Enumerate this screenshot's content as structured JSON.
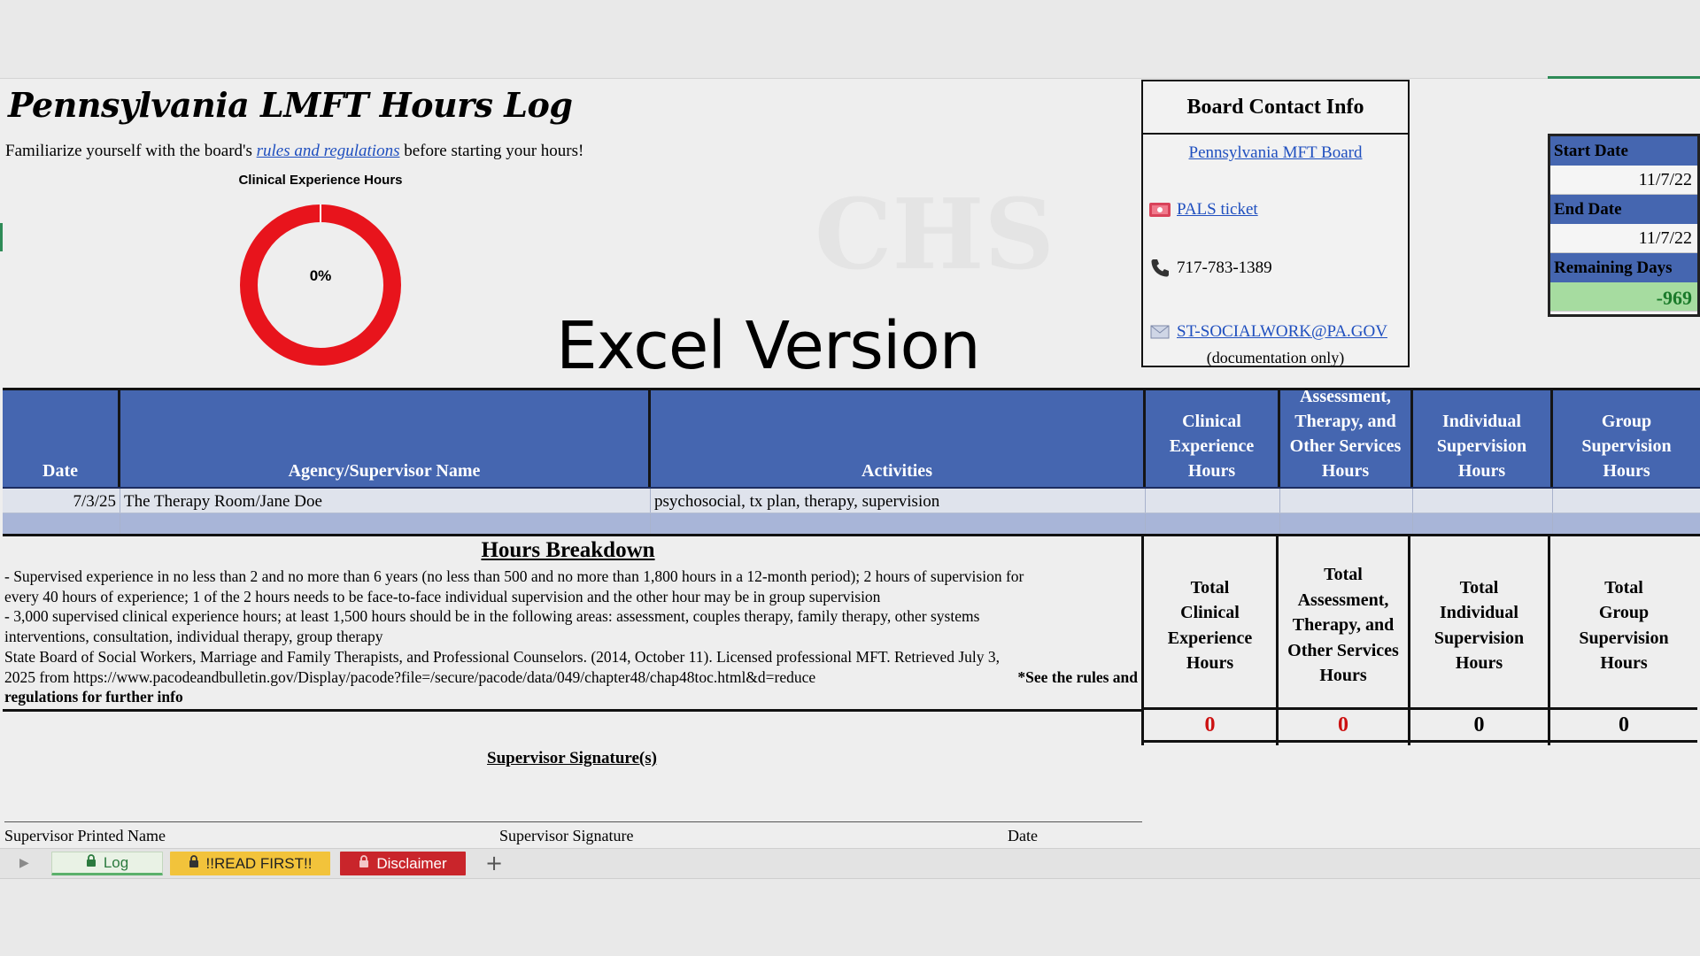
{
  "title": "Pennsylvania LMFT Hours Log",
  "intro": {
    "before": "Familiarize yourself with the board's ",
    "link": "rules and regulations",
    "after": " before starting your hours!"
  },
  "donut": {
    "title": "Clinical Experience Hours",
    "percent_label": "0%",
    "percent": 0,
    "color": "#e8141c"
  },
  "overlay_text": "Excel Version",
  "watermark": "CHS",
  "board": {
    "heading": "Board Contact Info",
    "board_link": "Pennsylvania MFT Board",
    "pals_link": "PALS ticket",
    "pals_icon": "ticket-icon",
    "phone": "717-783-1389",
    "phone_icon": "phone-icon",
    "email": "ST-SOCIALWORK@PA.GOV",
    "email_icon": "email-icon",
    "email_note": "(documentation only)"
  },
  "dates": {
    "start_label": "Start Date",
    "start_value": "11/7/22",
    "end_label": "End Date",
    "end_value": "11/7/22",
    "remaining_label": "Remaining Days",
    "remaining_value": "-969"
  },
  "table": {
    "headers": {
      "date": "Date",
      "agency": "Agency/Supervisor Name",
      "activities": "Activities",
      "clinical": [
        "Clinical",
        "Experience",
        "Hours"
      ],
      "assessment": [
        "Assessment,",
        "Therapy, and",
        "Other Services",
        "Hours"
      ],
      "individual": [
        "Individual",
        "Supervision",
        "Hours"
      ],
      "group": [
        "Group",
        "Supervision",
        "Hours"
      ]
    },
    "rows": [
      {
        "date": "7/3/25",
        "agency": "The Therapy Room/Jane Doe",
        "activities": "psychosocial, tx plan, therapy, supervision",
        "clinical": "",
        "assessment": "",
        "individual": "",
        "group": ""
      },
      {
        "date": "",
        "agency": "",
        "activities": "",
        "clinical": "",
        "assessment": "",
        "individual": "",
        "group": ""
      }
    ]
  },
  "breakdown": {
    "title": "Hours Breakdown",
    "lines": [
      "- Supervised experience in no less than 2 and no more than 6 years (no less than 500 and no more than 1,800 hours in a 12-month period); 2 hours of supervision for",
      "every 40 hours of experience; 1 of the 2 hours needs to be face-to-face individual supervision and the other hour may be in group supervision",
      "- 3,000 supervised clinical experience hours; at least 1,500 hours should be in the following areas: assessment, couples therapy, family therapy, other systems",
      "interventions, consultation, individual therapy, group therapy",
      "State Board of Social Workers, Marriage and Family Therapists, and Professional Counselors. (2014, October 11). Licensed professional MFT. Retrieved July 3,",
      "2025 from https://www.pacodeandbulletin.gov/Display/pacode?file=/secure/pacode/data/049/chapter48/chap48toc.html&d=reduce"
    ],
    "note_a": "*See the rules and",
    "note_b": "regulations for further info"
  },
  "totals": {
    "clinical_label": [
      "Total",
      "Clinical",
      "Experience",
      "Hours"
    ],
    "assessment_label": [
      "Total",
      "Assessment,",
      "Therapy, and",
      "Other Services",
      "Hours"
    ],
    "individual_label": [
      "Total",
      "Individual",
      "Supervision",
      "Hours"
    ],
    "group_label": [
      "Total",
      "Group",
      "Supervision",
      "Hours"
    ],
    "clinical_value": "0",
    "assessment_value": "0",
    "individual_value": "0",
    "group_value": "0"
  },
  "signature": {
    "title": "Supervisor Signature(s)",
    "printed_name": "Supervisor Printed Name",
    "signature": "Supervisor Signature",
    "date": "Date"
  },
  "tabs": {
    "log": "Log",
    "read_first": "!!READ FIRST!!",
    "disclaimer": "Disclaimer",
    "lock_icon": "lock-icon",
    "add_icon": "plus-icon"
  }
}
